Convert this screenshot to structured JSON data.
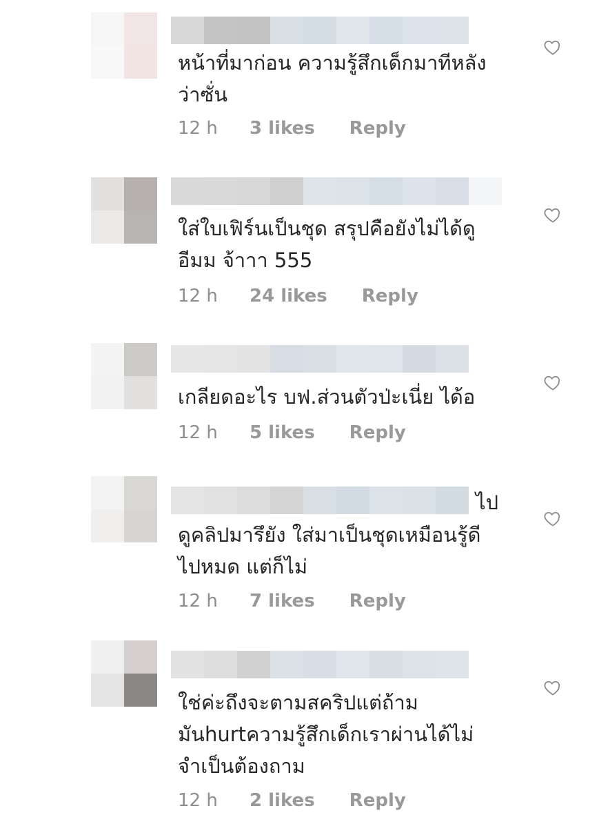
{
  "comments": [
    {
      "text": "หน้าที่มาก่อน ความรู้สึกเด็กมาทีหลัง\nว่าซั่น",
      "time": "12 h",
      "likes": "3 likes",
      "reply": "Reply",
      "avatar_colors": [
        "#f6f6f6",
        "#f1e6e5",
        "#f8f8f8",
        "#f1e4e3"
      ],
      "name_colors": [
        "#d7d7d7",
        "#c4c4c4",
        "#c2c2c2",
        "#d9e0e6",
        "#d5dde4",
        "#e0e5ea",
        "#d6dfe7",
        "#dce3ea",
        "#dde3e8"
      ]
    },
    {
      "text": "ใส่ใบเฟิร์นเป็นชุด สรุปคือยังไม่ได้ดู\nอีมม จ้าาา 555",
      "time": "12 h",
      "likes": "24 likes",
      "reply": "Reply",
      "avatar_colors": [
        "#e2e0df",
        "#b6b1b0",
        "#ebe8e8",
        "#b8b4b4"
      ],
      "name_colors": [
        "#dadada",
        "#d9d9d9",
        "#d7d7d7",
        "#cfcfcf",
        "#dfe4e9",
        "#dbe2e8",
        "#d5dde5",
        "#dde3ea",
        "#d9dfe6",
        "#f3f5f7"
      ]
    },
    {
      "text": "เกลียดอะไร บฟ.ส่วนตัวป่ะเนี่ย ได้อ",
      "time": "12 h",
      "likes": "5 likes",
      "reply": "Reply",
      "avatar_colors": [
        "#f4f4f4",
        "#cbcac7",
        "#f2f2f2",
        "#e1e0de"
      ],
      "name_colors": [
        "#e7e7e7",
        "#e6e6e6",
        "#e3e3e3",
        "#d6dde4",
        "#d9e0e6",
        "#e0e6eb",
        "#dfe5ea",
        "#d4dbe3",
        "#dbe1e7"
      ]
    },
    {
      "text": "ดูคลิปมารึยัง ใส่มาเป็นชุดเหมือนรู้ดี\nไปหมด แต่ก็ไม่",
      "tail": "ไป",
      "time": "12 h",
      "likes": "7 likes",
      "reply": "Reply",
      "avatar_colors": [
        "#f3f3f3",
        "#d9d7d4",
        "#f0efee",
        "#d6d5d3"
      ],
      "name_colors": [
        "#e4e4e4",
        "#e1e1e1",
        "#dcdcdc",
        "#d4d4d4",
        "#d8dfe5",
        "#d2dbe3",
        "#dbe2e8",
        "#dae1e7",
        "#d3dbe3"
      ]
    },
    {
      "text": "ใช่ค่ะถึงจะตามสคริปแต่ถ้าม\nมันhurtความรู้สึกเด็กเราผ่านได้ไม่\nจำเป็นต้องถาม",
      "time": "12 h",
      "likes": "2 likes",
      "reply": "Reply",
      "avatar_colors": [
        "#f0f0f0",
        "#d5cfcf",
        "#e4e4e4",
        "#8a8785"
      ],
      "name_colors": [
        "#e2e2e2",
        "#dedede",
        "#d1d1d1",
        "#dbe1e7",
        "#d7dee5",
        "#dfe5ea",
        "#d8dee4",
        "#dce2e8",
        "#dfe4e9"
      ]
    }
  ],
  "icons": {
    "like": "heart-outline-icon"
  }
}
